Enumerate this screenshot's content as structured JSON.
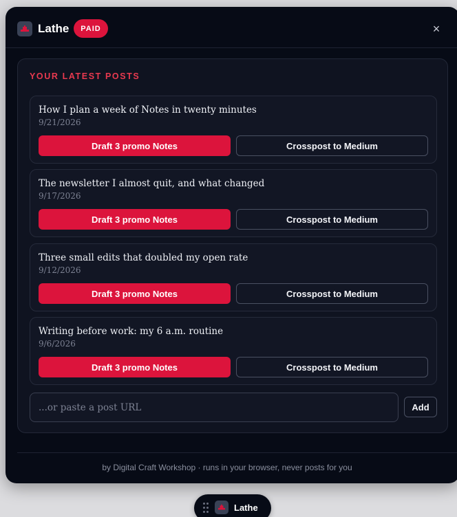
{
  "app": {
    "title": "Lathe",
    "badge": "PAID",
    "icon": "lathe-logo-icon",
    "close_icon": "×"
  },
  "colors": {
    "accent": "#dc143c",
    "panel_bg": "#070b16",
    "card_bg": "#0f1320"
  },
  "section": {
    "title": "YOUR LATEST POSTS"
  },
  "posts": [
    {
      "title": "How I plan a week of Notes in twenty minutes",
      "date": "9/21/2026",
      "draft_label": "Draft 3 promo Notes",
      "crosspost_label": "Crosspost to Medium"
    },
    {
      "title": "The newsletter I almost quit, and what changed",
      "date": "9/17/2026",
      "draft_label": "Draft 3 promo Notes",
      "crosspost_label": "Crosspost to Medium"
    },
    {
      "title": "Three small edits that doubled my open rate",
      "date": "9/12/2026",
      "draft_label": "Draft 3 promo Notes",
      "crosspost_label": "Crosspost to Medium"
    },
    {
      "title": "Writing before work: my 6 a.m. routine",
      "date": "9/6/2026",
      "draft_label": "Draft 3 promo Notes",
      "crosspost_label": "Crosspost to Medium"
    }
  ],
  "url_input": {
    "placeholder": "...or paste a post URL",
    "value": ""
  },
  "add_button": {
    "label": "Add"
  },
  "footer": {
    "text": "by Digital Craft Workshop · runs in your browser, never posts for you"
  },
  "launcher": {
    "label": "Lathe",
    "grip_icon": "drag-handle-icon"
  }
}
